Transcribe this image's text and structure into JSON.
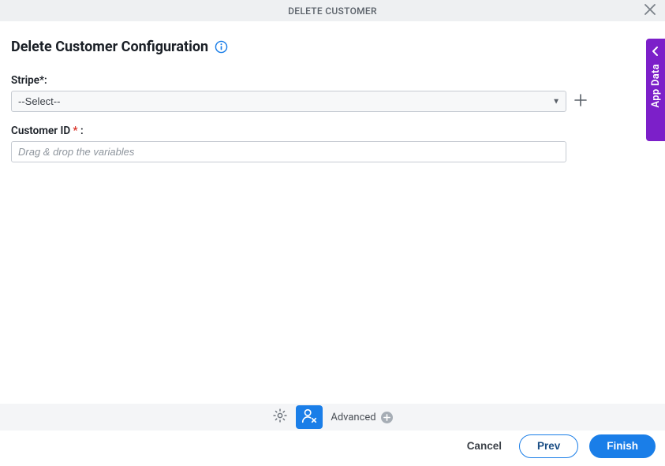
{
  "header": {
    "title": "DELETE CUSTOMER"
  },
  "page": {
    "title": "Delete Customer Configuration"
  },
  "fields": {
    "stripe": {
      "label": "Stripe",
      "required_suffix": "*:",
      "selected": "--Select--"
    },
    "customer_id": {
      "label": "Customer ID ",
      "required_mark": "*",
      "label_suffix": " :",
      "placeholder": "Drag & drop the variables",
      "value": ""
    }
  },
  "side_tab": {
    "label": "App Data"
  },
  "toolbar": {
    "advanced_label": "Advanced"
  },
  "footer": {
    "cancel": "Cancel",
    "prev": "Prev",
    "finish": "Finish"
  }
}
